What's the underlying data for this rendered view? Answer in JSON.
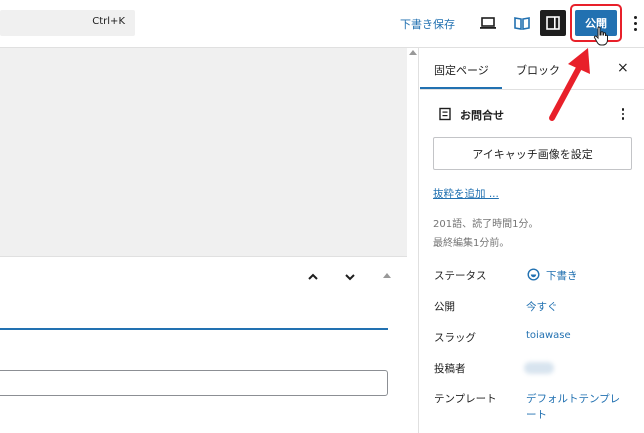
{
  "topbar": {
    "command_shortcut": "Ctrl+K",
    "save_draft_label": "下書き保存",
    "publish_label": "公開"
  },
  "sidebar": {
    "tabs": [
      {
        "label": "固定ページ",
        "active": true
      },
      {
        "label": "ブロック",
        "active": false
      }
    ],
    "close_label": "×",
    "document": {
      "title": "お問合せ",
      "featured_image_label": "アイキャッチ画像を設定",
      "excerpt_link": "抜粋を追加 ...",
      "word_count": "201語、読了時間1分。",
      "last_edited": "最終編集1分前。"
    },
    "rows": {
      "status": {
        "label": "ステータス",
        "value": "下書き"
      },
      "publish": {
        "label": "公開",
        "value": "今すぐ"
      },
      "slug": {
        "label": "スラッグ",
        "value": "toiawase"
      },
      "author": {
        "label": "投稿者"
      },
      "template": {
        "label": "テンプレート",
        "value": "デフォルトテンプレート"
      }
    }
  },
  "colors": {
    "accent": "#2271b1",
    "dark": "#1e1e1e",
    "highlight": "#e8202a",
    "canvas": "#f0f0f0"
  },
  "icons": {
    "preview": "desktop-icon",
    "view": "book-icon",
    "settings": "sidebar-panel-icon",
    "more": "more-vertical-icon",
    "document": "document-icon",
    "status": "draft-status-icon"
  }
}
